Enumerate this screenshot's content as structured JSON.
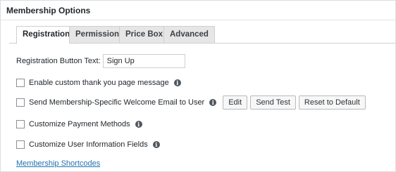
{
  "panel": {
    "title": "Membership Options"
  },
  "tabs": [
    {
      "label": "Registration",
      "active": true
    },
    {
      "label": "Permissions",
      "active": false
    },
    {
      "label": "Price Box",
      "active": false
    },
    {
      "label": "Advanced",
      "active": false
    }
  ],
  "registration": {
    "button_text_label": "Registration Button Text:",
    "button_text_value": "Sign Up",
    "options": [
      {
        "label": "Enable custom thank you page message",
        "checked": false
      },
      {
        "label": "Send Membership-Specific Welcome Email to User",
        "checked": false
      },
      {
        "label": "Customize Payment Methods",
        "checked": false
      },
      {
        "label": "Customize User Information Fields",
        "checked": false
      }
    ],
    "email_buttons": {
      "edit": "Edit",
      "send_test": "Send Test",
      "reset": "Reset to Default"
    },
    "shortcodes_link": "Membership Shortcodes"
  },
  "icons": {
    "info": "info-icon",
    "checkbox": "checkbox-empty"
  },
  "colors": {
    "link": "#2271b1",
    "active_tab_bg": "#ffffff",
    "inactive_tab_bg": "#e6e6e6"
  }
}
